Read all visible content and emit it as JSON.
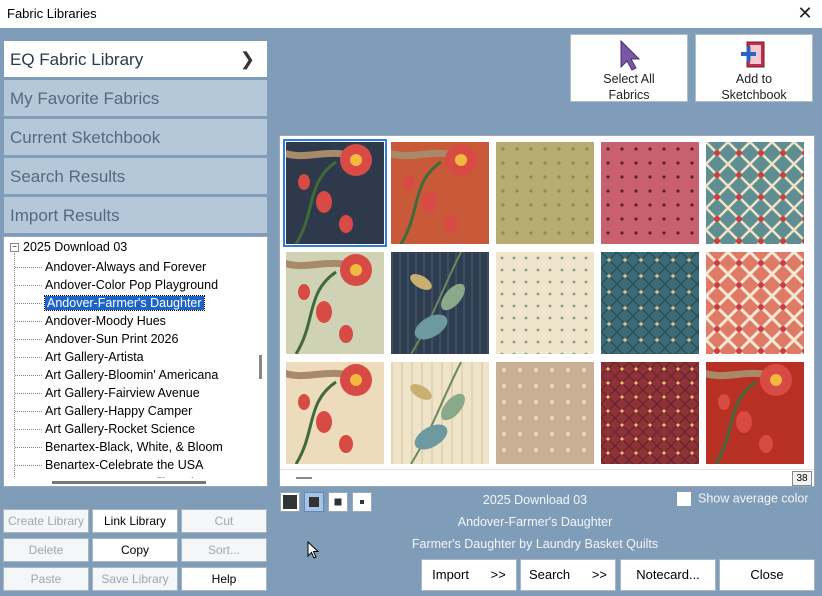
{
  "window": {
    "title": "Fabric Libraries",
    "close_glyph": "✕"
  },
  "libraries": [
    {
      "label": "EQ Fabric Library",
      "active": true
    },
    {
      "label": "My Favorite Fabrics",
      "active": false
    },
    {
      "label": "Current Sketchbook",
      "active": false
    },
    {
      "label": "Search Results",
      "active": false
    },
    {
      "label": "Import Results",
      "active": false
    }
  ],
  "tree": {
    "root": "2025 Download 03",
    "items": [
      "Andover-Always and Forever",
      "Andover-Color Pop Playground",
      "Andover-Farmer's Daughter",
      "Andover-Moody Hues",
      "Andover-Sun Print 2026",
      "Art Gallery-Artista",
      "Art Gallery-Bloomin' Americana",
      "Art Gallery-Fairview Avenue",
      "Art Gallery-Happy Camper",
      "Art Gallery-Rocket Science",
      "Benartex-Black, White, & Bloom",
      "Benartex-Celebrate the USA",
      "Benartex-Nature Unfiltered"
    ],
    "selected_index": 2
  },
  "library_buttons": {
    "create": "Create Library",
    "link": "Link Library",
    "cut": "Cut",
    "delete": "Delete",
    "copy": "Copy",
    "sort": "Sort...",
    "paste": "Paste",
    "save": "Save Library",
    "help": "Help"
  },
  "actions": {
    "select_all": [
      "Select All",
      "Fabrics"
    ],
    "add_sketchbook": [
      "Add to",
      "Sketchbook"
    ]
  },
  "grid": {
    "count": "38",
    "selected_index": 0
  },
  "info": {
    "collection": "2025 Download 03",
    "library": "Andover-Farmer's Daughter",
    "description": "Farmer's Daughter by Laundry Basket Quilts"
  },
  "show_average_color": "Show average color",
  "bottom_buttons": {
    "import": "Import      >>",
    "search": "Search      >>",
    "notecard": "Notecard...",
    "close": "Close"
  },
  "colors": {
    "background": "#7f9cb8",
    "selection": "#1c64c8",
    "active_tab": "#ffffff",
    "inactive_tab": "#b5c8da"
  }
}
